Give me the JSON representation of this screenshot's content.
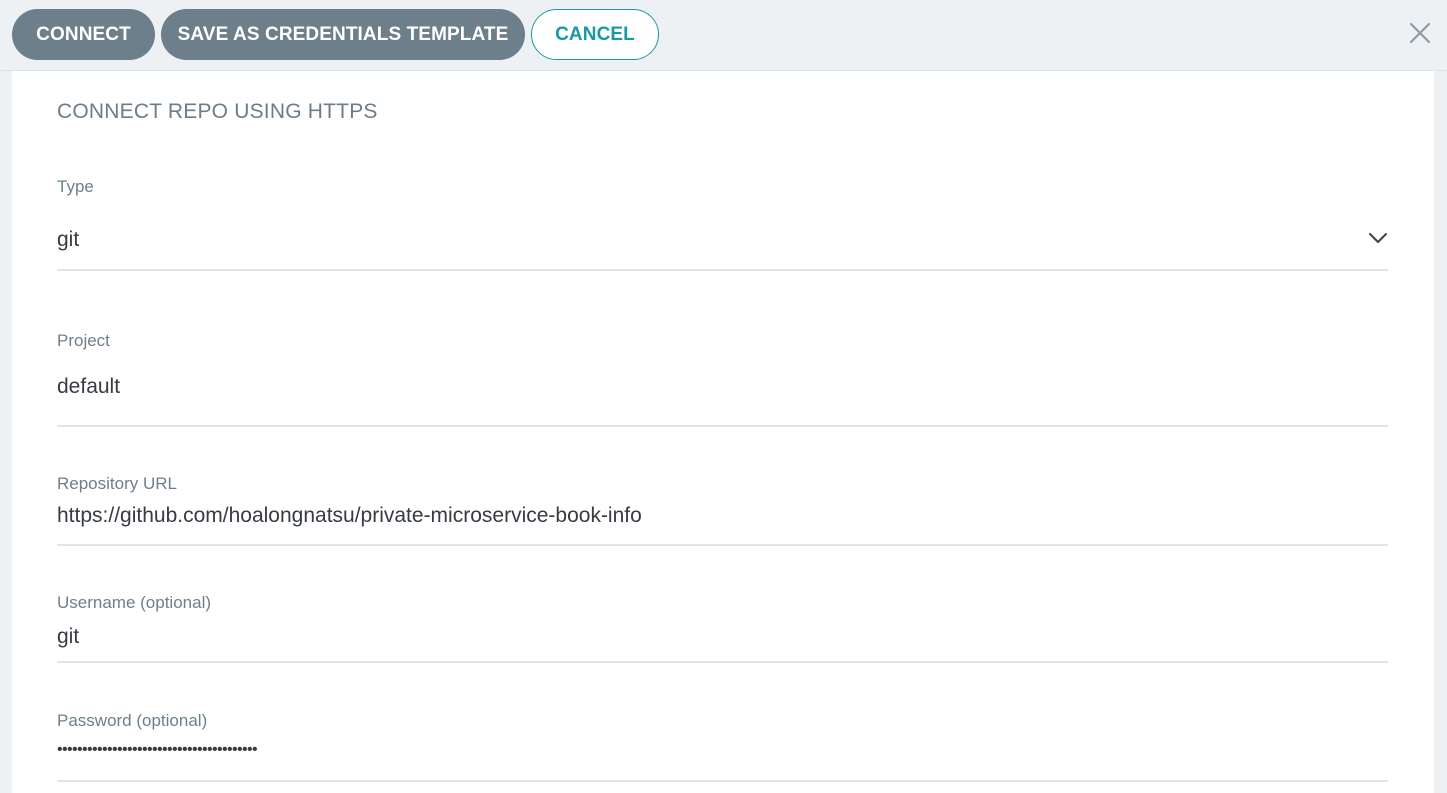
{
  "toolbar": {
    "connect_label": "CONNECT",
    "save_template_label": "SAVE AS CREDENTIALS TEMPLATE",
    "cancel_label": "CANCEL",
    "close_icon": "close-icon"
  },
  "form": {
    "heading": "CONNECT REPO USING HTTPS",
    "type": {
      "label": "Type",
      "value": "git"
    },
    "project": {
      "label": "Project",
      "value": "default"
    },
    "repo_url": {
      "label": "Repository URL",
      "value": "https://github.com/hoalongnatsu/private-microservice-book-info"
    },
    "username": {
      "label": "Username (optional)",
      "value": "git"
    },
    "password": {
      "label": "Password (optional)",
      "value": "••••••••••••••••••••••••••••••••••••••••"
    }
  },
  "colors": {
    "accent": "#189aa0",
    "button_dark": "#6d7f8b",
    "toolbar_bg": "#eef1f4"
  }
}
